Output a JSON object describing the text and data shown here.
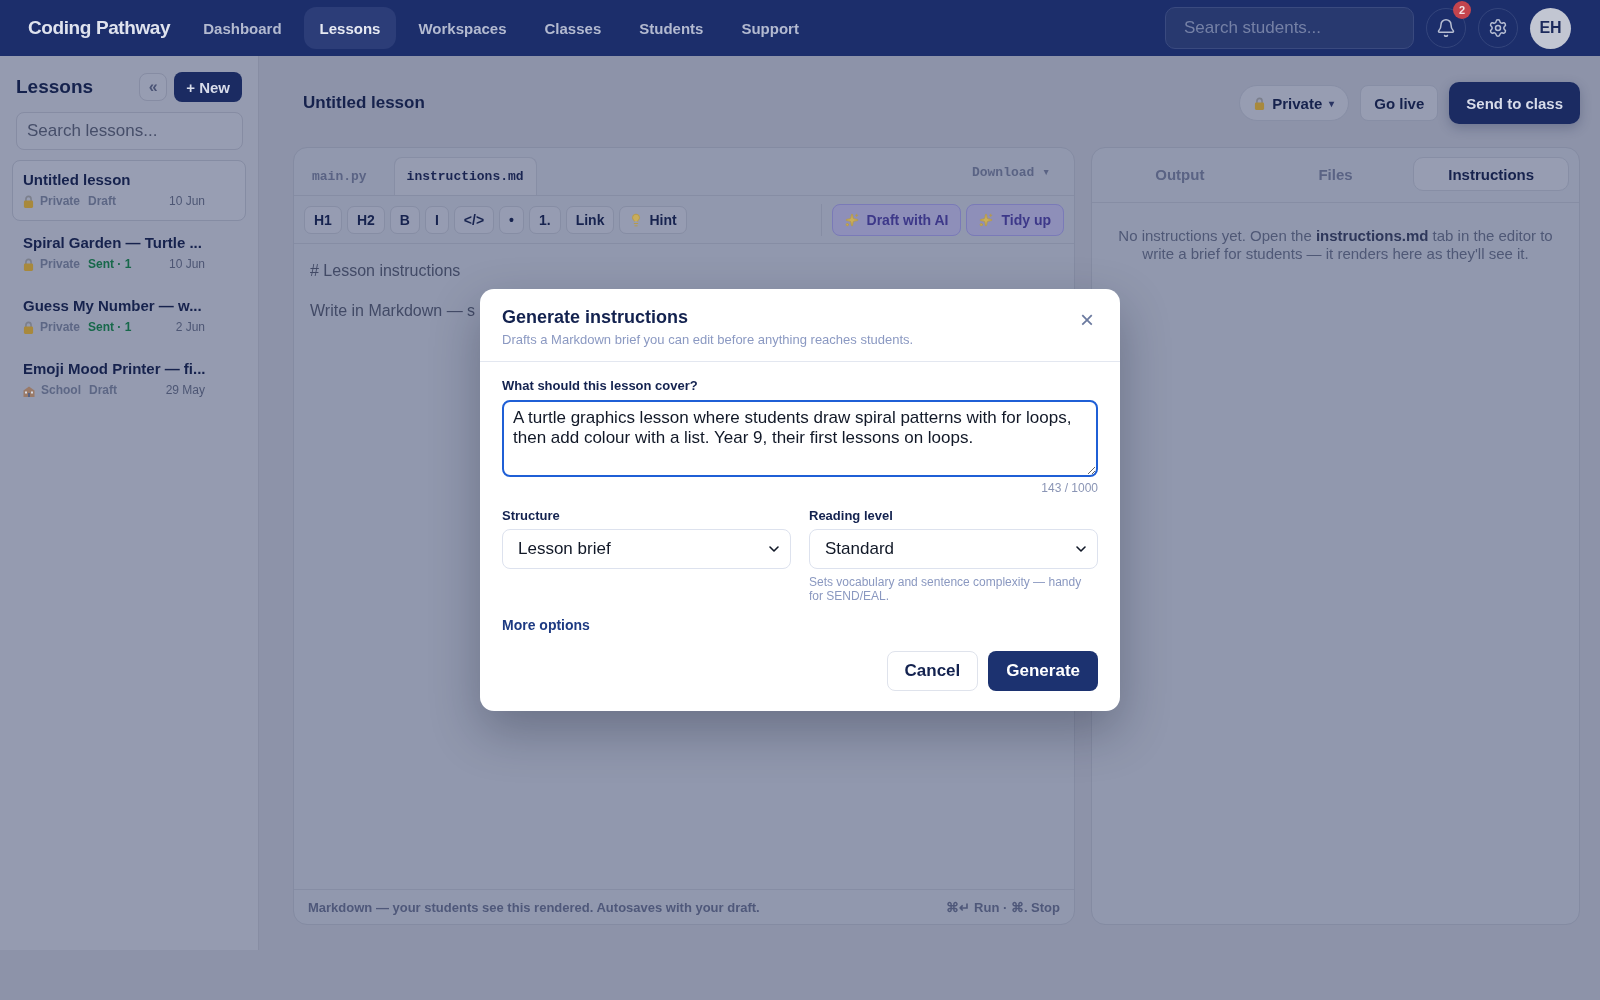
{
  "topbar": {
    "logo": "Coding Pathway",
    "nav": [
      {
        "label": "Dashboard",
        "selected": false
      },
      {
        "label": "Lessons",
        "selected": true
      },
      {
        "label": "Workspaces",
        "selected": false
      },
      {
        "label": "Classes",
        "selected": false
      },
      {
        "label": "Students",
        "selected": false
      },
      {
        "label": "Support",
        "selected": false
      }
    ],
    "search": {
      "placeholder": "Search students..."
    },
    "notification_count": "2",
    "avatar": "EH"
  },
  "sidebar": {
    "title": "Lessons",
    "collapse": "«",
    "new_button": "+ New",
    "search": {
      "placeholder": "Search lessons..."
    },
    "lessons": [
      {
        "title": "Untitled lesson",
        "kind": "private",
        "visibility": "Private",
        "status": "Draft",
        "color": "#5d6785",
        "date": "10 Jun",
        "selected": true
      },
      {
        "title": "Spiral Garden — Turtle ...",
        "kind": "private",
        "visibility": "Private",
        "status": "Sent · 1",
        "color": "#17684a",
        "date": "10 Jun",
        "selected": false
      },
      {
        "title": "Guess My Number — w...",
        "kind": "private",
        "visibility": "Private",
        "status": "Sent · 1",
        "color": "#17684a",
        "date": "2 Jun",
        "selected": false
      },
      {
        "title": "Emoji Mood Printer — fi...",
        "kind": "school",
        "visibility": "School",
        "status": "Draft",
        "color": "#5d6785",
        "date": "29 May",
        "selected": false
      }
    ]
  },
  "lesson": {
    "title": "Untitled lesson",
    "privacy": {
      "label": "Private",
      "caret": "▾"
    },
    "go_live": "Go live",
    "send": "Send to class"
  },
  "editor": {
    "tabs": [
      {
        "label": "main.py",
        "selected": false
      },
      {
        "label": "instructions.md",
        "selected": true
      }
    ],
    "download": "Download ▾",
    "toolbar": [
      {
        "label": "H1",
        "kind": "text"
      },
      {
        "label": "H2",
        "kind": "text"
      },
      {
        "label": "B",
        "kind": "text"
      },
      {
        "label": "I",
        "kind": "text"
      },
      {
        "label": "</>",
        "kind": "text"
      },
      {
        "label": "•",
        "kind": "text"
      },
      {
        "label": "1.",
        "kind": "text"
      },
      {
        "label": "Link",
        "kind": "text"
      },
      {
        "label": "Hint",
        "kind": "hint"
      }
    ],
    "ai_buttons": [
      "Draft with AI",
      "Tidy up"
    ],
    "lines": [
      "# Lesson instructions",
      "Write in Markdown — s"
    ],
    "footer": "Markdown — your students see this rendered. Autosaves with your draft.",
    "shortcuts": "⌘↵ Run · ⌘. Stop"
  },
  "preview": {
    "tabs": [
      {
        "label": "Output",
        "selected": false
      },
      {
        "label": "Files",
        "selected": false
      },
      {
        "label": "Instructions",
        "selected": true
      }
    ],
    "empty_text": "No instructions yet. Open the **instructions.md** tab in the editor to write a brief for students — it renders here as they'll see it."
  },
  "dialog": {
    "title": "Generate instructions",
    "subtitle": "Drafts a Markdown brief you can edit before anything reaches students.",
    "close": "×",
    "prompt": {
      "label": "What should this lesson cover?",
      "value": "A turtle graphics lesson where students draw spiral patterns with for loops, then add colour with a list. Year 9, their first lessons on loops.",
      "counter": "143 / 1000"
    },
    "selects": [
      {
        "label": "Structure",
        "value": "Lesson brief"
      },
      {
        "label": "Reading level",
        "value": "Standard",
        "hint": "Sets vocabulary and sentence complexity — handy for SEND/EAL."
      }
    ],
    "more_options": "More options",
    "buttons": [
      {
        "label": "Cancel",
        "kind": "cancel"
      },
      {
        "label": "Generate",
        "kind": "confirm"
      }
    ]
  }
}
